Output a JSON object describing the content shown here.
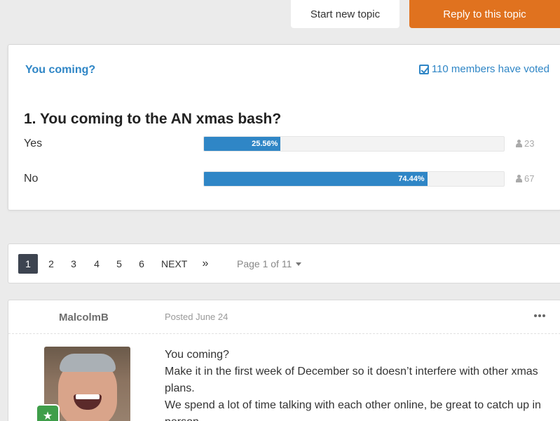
{
  "topbar": {
    "start_topic_label": "Start new topic",
    "reply_label": "Reply to this topic"
  },
  "poll": {
    "title": "You coming?",
    "votes_label": "110 members have voted",
    "question": "1. You coming to the AN xmas bash?",
    "options": [
      {
        "label": "Yes",
        "percent_label": "25.56%",
        "percent": 25.56,
        "count": "23"
      },
      {
        "label": "No",
        "percent_label": "74.44%",
        "percent": 74.44,
        "count": "67"
      }
    ]
  },
  "pagination": {
    "pages": [
      "1",
      "2",
      "3",
      "4",
      "5",
      "6"
    ],
    "active_page": "1",
    "next_label": "NEXT",
    "last_label": "»",
    "page_select_label": "Page 1 of 11"
  },
  "post": {
    "author": "MalcolmB",
    "date": "Posted June 24",
    "body": [
      "You coming?",
      "Make it in the first week of December so it doesn’t interfere with other xmas plans.",
      "We spend a lot of time talking with each other online, be great to catch up in person."
    ]
  },
  "icons": {
    "votes": "check-square-icon",
    "count": "user-icon",
    "more": "ellipsis-icon",
    "select": "caret-down-icon",
    "badge": "star-badge-icon"
  },
  "colors": {
    "accent": "#2f86c6",
    "reply_button": "#e0721f",
    "active_page": "#3d4450",
    "badge": "#3f9e4a"
  }
}
